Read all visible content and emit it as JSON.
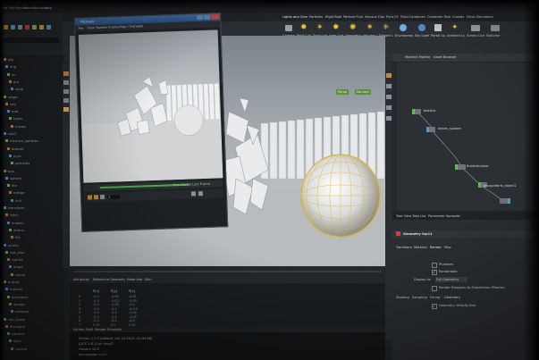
{
  "window": {
    "title": "Houdini FX",
    "menus": [
      "File",
      "Edit",
      "Render",
      "Assets",
      "Windows",
      "Help"
    ]
  },
  "shelf": {
    "tabs": [
      "Lights and Cameras",
      "Particles",
      "Rigid Bodies",
      "Particle Fluids",
      "Viscous Fluids",
      "Pyro FX",
      "Fluid Containers",
      "Container Tools",
      "Crowds",
      "Drive Simulation"
    ],
    "tools": [
      "Camera",
      "Point Light",
      "Spot Light",
      "Area Light",
      "Geometry Light",
      "Volume Light",
      "Distant Light",
      "Environment Light",
      "Sky Light",
      "Portal Light",
      "Ambient Light",
      "Stereo Camera",
      "Switcher"
    ]
  },
  "tree": {
    "items": [
      "obj",
      "img",
      "ch",
      "out",
      "shop",
      "stage",
      "vex",
      "mat",
      "tasks",
      "furdes",
      "cop2",
      "fracture_spheres",
      "dopnet",
      "pyro",
      "particles",
      "box",
      "sphere",
      "file",
      "merge",
      "null",
      "transform",
      "fetch",
      "impact",
      "debris",
      "flip",
      "points",
      "rbd_glue",
      "ropnet",
      "stage",
      "cache",
      "output",
      "mantra",
      "geometry",
      "wedge",
      "network",
      "rbd_solver",
      "filecache",
      "camera",
      "light",
      "subnet"
    ]
  },
  "viewport": {
    "badge_1": "Persp",
    "badge_2": "No cam"
  },
  "flipbook": {
    "title": "Flipbook",
    "menus": [
      "File",
      "View",
      "Render",
      "Frame",
      "Help",
      "Channels"
    ],
    "status": "Rom Cache Last Frame",
    "frame": "1"
  },
  "network": {
    "tabs": [
      "Material Palette",
      "Asset Browser"
    ],
    "nodes": [
      {
        "label": "bdebris"
      },
      {
        "label": "debris_system"
      },
      {
        "label": "fluidsimulator"
      },
      {
        "label": "hvdsimulator"
      },
      {
        "label": "groupdebris_object2"
      }
    ]
  },
  "params": {
    "tabs": [
      "Tree View",
      "Take List",
      "Parameter Spreadsheet"
    ],
    "node_title": "Geometry  fxp11",
    "sub_tabs": [
      "Transform",
      "Material",
      "Render",
      "Misc"
    ],
    "rows": [
      {
        "label": "Phantom"
      },
      {
        "label": "Renderable"
      },
      {
        "label": "Display As",
        "value": "Full Geometry"
      },
      {
        "label": "",
        "value": "Render Polygons As Subdivision (Mantra)"
      }
    ],
    "sub_tabs_2": [
      "Shading",
      "Sampling",
      "Dicing",
      "Geometry"
    ],
    "extra": "Geometry Velocity Blur"
  },
  "spreadsheet": {
    "tabs": [
      "Attributes",
      "Reference Geometry",
      "Node Info",
      "Skin"
    ],
    "columns": [
      "",
      "P[x]",
      "P[y]",
      "P[z]"
    ],
    "rows": [
      [
        "0",
        "-0.0",
        "-0.05",
        "-0.01"
      ],
      [
        "1",
        "-0.3",
        "-0.0.1",
        "-0.05"
      ],
      [
        "2",
        "-0.3",
        "-0.05",
        "-0.1"
      ],
      [
        "3",
        "-0.3",
        "-0.1",
        "-0.0.5"
      ],
      [
        "4",
        "-0.3",
        "-0.0",
        "-0.01"
      ],
      [
        "5",
        "-0.3",
        "-0.0",
        "-0.05"
      ],
      [
        "6",
        "-0.3",
        "-0.1",
        "-0.0"
      ],
      [
        "7",
        "0.35",
        "0.0",
        "0.10"
      ]
    ]
  },
  "console": {
    "tabs": [
      "Python Shell",
      "Render Scheduler"
    ],
    "lines": [
      "Python 2.7.5 (default, Oct 14 2013, 22:04:36)",
      "[GCC 4.8.2] on linux2",
      "Houdini 14.0",
      "hou.session >>>"
    ]
  }
}
